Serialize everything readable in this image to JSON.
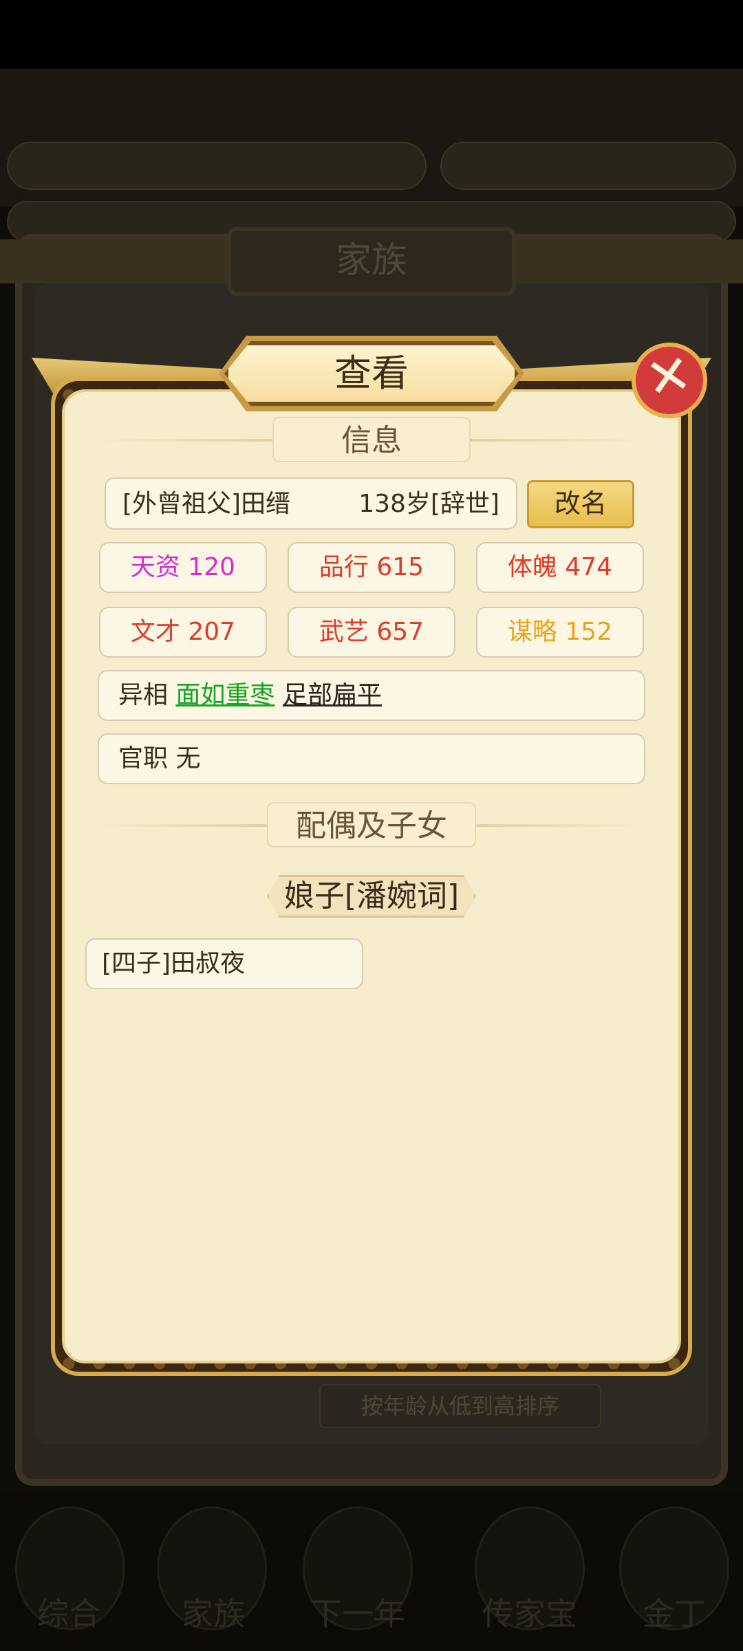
{
  "background": {
    "panel_title": "家族",
    "sort_button": "按年龄从低到高排序",
    "nav": [
      "综合",
      "家族",
      "下一年",
      "传家宝",
      "金丁"
    ]
  },
  "dialog": {
    "title": "查看",
    "info_header": "信息",
    "name_line": "[外曾祖父]田缙",
    "age_line": "138岁[辞世]",
    "rename_label": "改名",
    "stats": [
      {
        "label": "天资 120",
        "color": "#d62ad8"
      },
      {
        "label": "品行 615",
        "color": "#e03a2a"
      },
      {
        "label": "体魄 474",
        "color": "#e03a2a"
      },
      {
        "label": "文才 207",
        "color": "#e03a2a"
      },
      {
        "label": "武艺 657",
        "color": "#e03a2a"
      },
      {
        "label": "谋略 152",
        "color": "#e9a41a"
      }
    ],
    "traits_label": "异相",
    "traits": [
      "面如重枣",
      "足部扁平"
    ],
    "office_label": "官职",
    "office_value": "无",
    "family_header": "配偶及子女",
    "spouse": "娘子[潘婉词]",
    "children": [
      "[四子]田叔夜"
    ]
  }
}
